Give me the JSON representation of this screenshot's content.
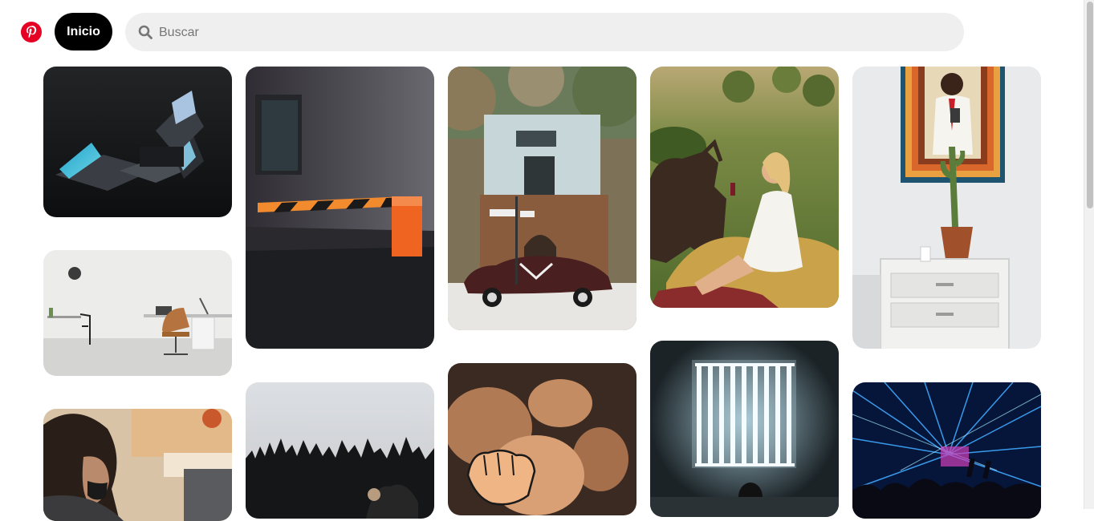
{
  "header": {
    "logo_icon": "pinterest-logo-icon",
    "home_label": "Inicio",
    "search": {
      "icon": "search-icon",
      "placeholder": "Buscar",
      "value": ""
    }
  },
  "colors": {
    "brand": "#e60023",
    "home_bg": "#000000",
    "search_bg": "#efefef"
  },
  "feed": {
    "pins": [
      {
        "subject": "laptops"
      },
      {
        "subject": "office-desk"
      },
      {
        "subject": "woman-curly-hair"
      },
      {
        "subject": "parking-barrier"
      },
      {
        "subject": "forest"
      },
      {
        "subject": "vintage-car-building"
      },
      {
        "subject": "fist-shadow"
      },
      {
        "subject": "woman-goat"
      },
      {
        "subject": "light-panel"
      },
      {
        "subject": "cactus-painting"
      },
      {
        "subject": "concert-lasers"
      }
    ]
  }
}
